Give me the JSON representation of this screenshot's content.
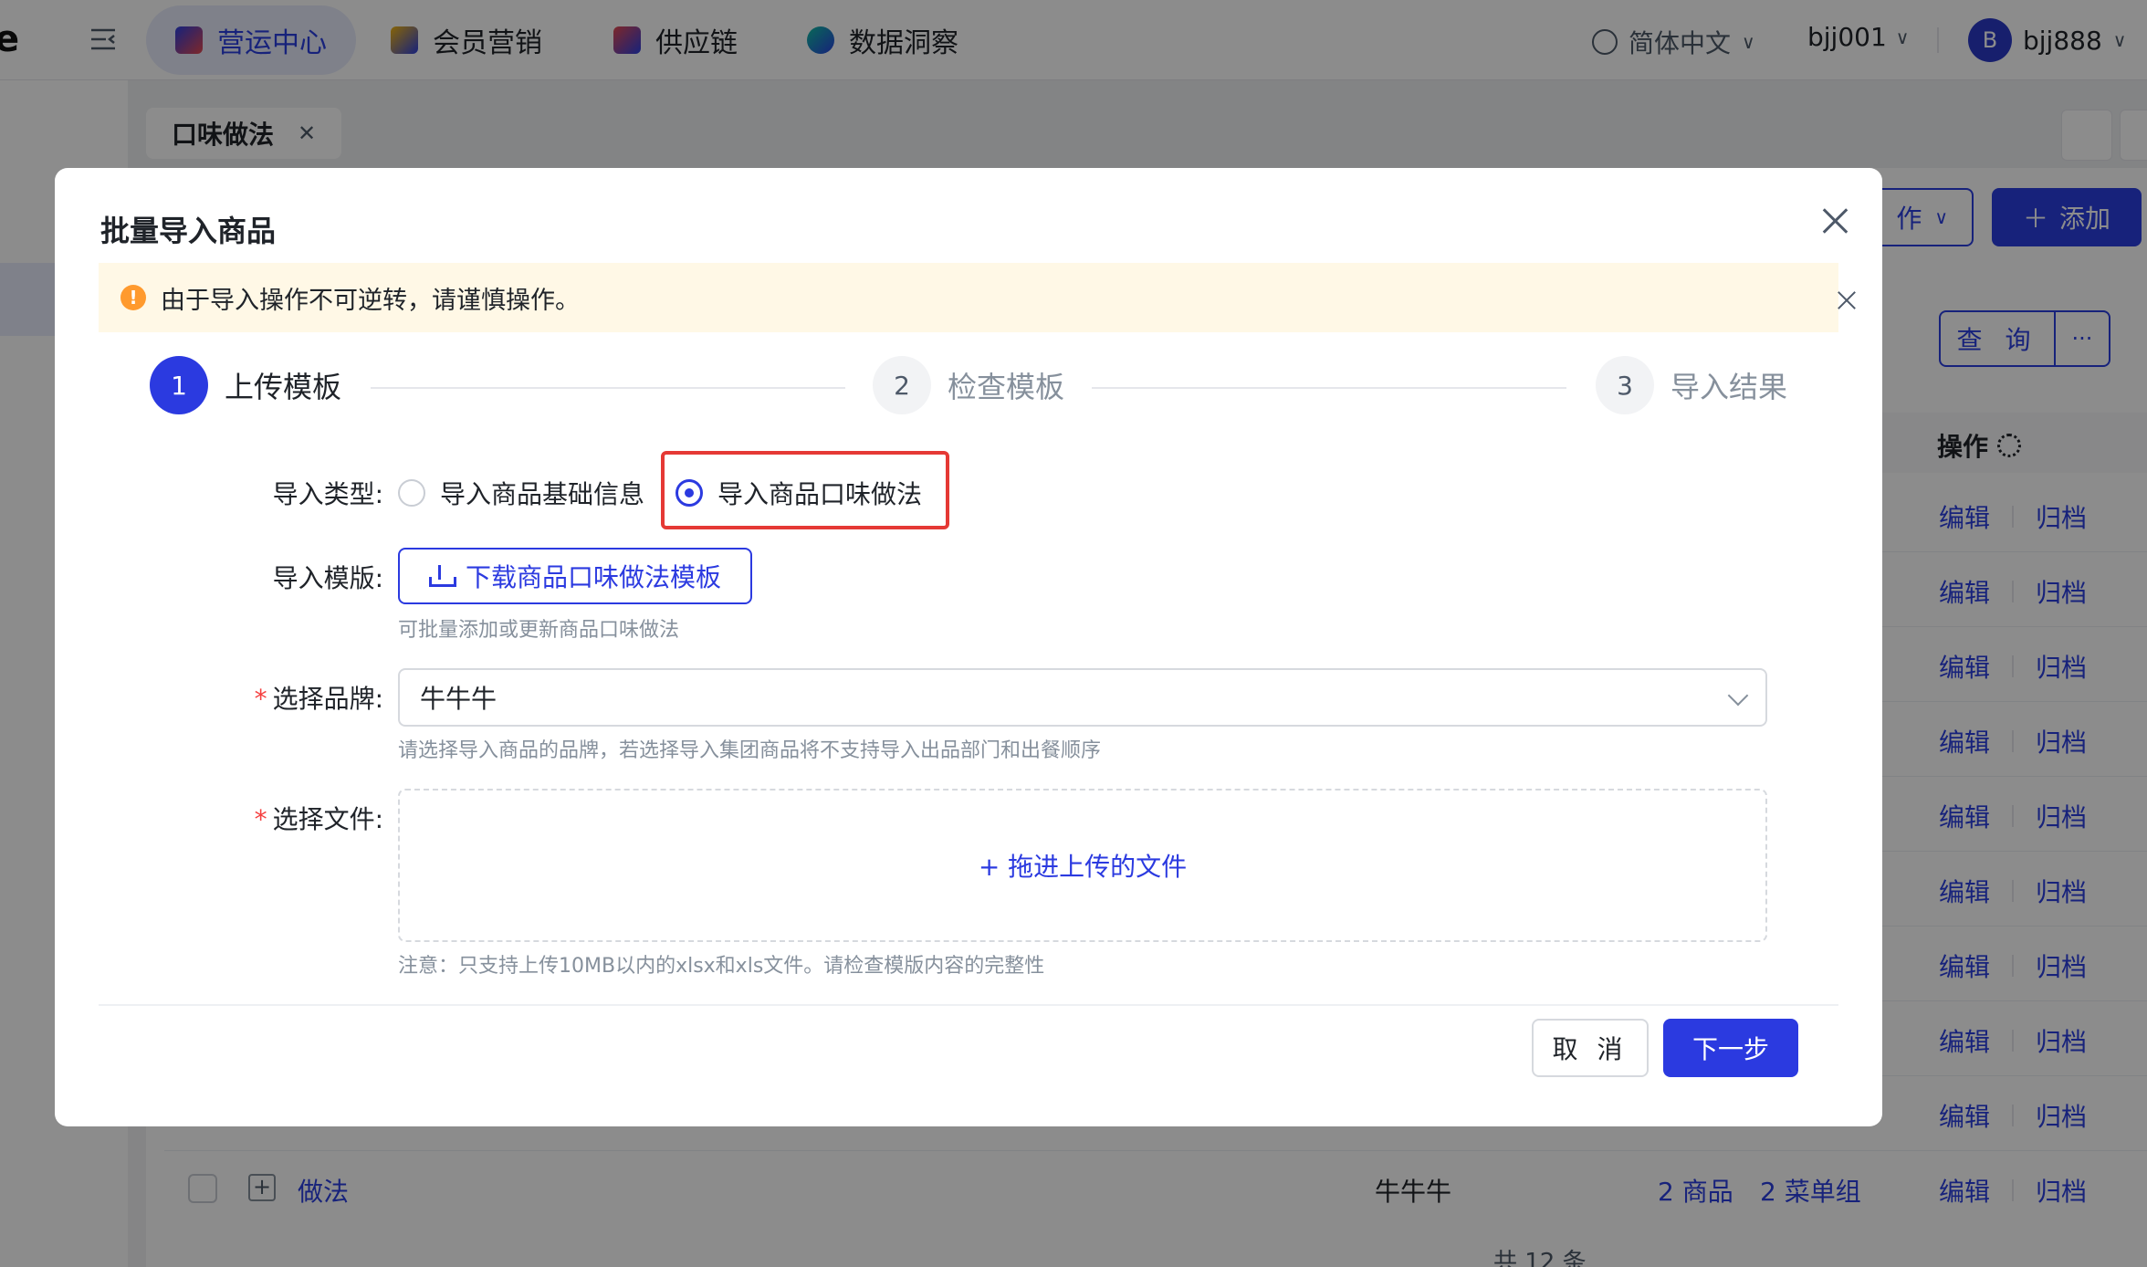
{
  "topbar": {
    "logo_fragment": "e",
    "nav": [
      {
        "label": "营运中心",
        "active": true,
        "icon": "ops-center-icon"
      },
      {
        "label": "会员营销",
        "active": false,
        "icon": "member-marketing-icon"
      },
      {
        "label": "供应链",
        "active": false,
        "icon": "supply-chain-icon"
      },
      {
        "label": "数据洞察",
        "active": false,
        "icon": "data-insight-icon"
      }
    ],
    "language": "简体中文",
    "account": "bjj001",
    "user_initial": "B",
    "user_name": "bjj888"
  },
  "tabs": [
    {
      "label": "口味做法",
      "closable": true
    }
  ],
  "background": {
    "batch_button_partial": "作",
    "add_button": "添加",
    "query_button": "查 询",
    "more_button": "···",
    "op_header": "操作",
    "row_edit": "编辑",
    "row_archive": "归档",
    "last_row": {
      "name": "做法",
      "brand": "牛牛牛",
      "product_count": "2 商品",
      "menu_group_count": "2 菜单组"
    },
    "pager_partial": "共 12 条"
  },
  "modal": {
    "title": "批量导入商品",
    "alert": "由于导入操作不可逆转，请谨慎操作。",
    "steps": [
      {
        "number": "1",
        "label": "上传模板",
        "status": "active"
      },
      {
        "number": "2",
        "label": "检查模板",
        "status": "pending"
      },
      {
        "number": "3",
        "label": "导入结果",
        "status": "pending"
      }
    ],
    "form": {
      "import_type_label": "导入类型:",
      "import_type_options": [
        {
          "label": "导入商品基础信息",
          "checked": false
        },
        {
          "label": "导入商品口味做法",
          "checked": true
        }
      ],
      "template_label": "导入模版:",
      "download_button": "下载商品口味做法模板",
      "template_hint": "可批量添加或更新商品口味做法",
      "brand_label": "选择品牌:",
      "brand_value": "牛牛牛",
      "brand_hint": "请选择导入商品的品牌，若选择导入集团商品将不支持导入出品部门和出餐顺序",
      "file_label": "选择文件:",
      "upload_text": "+ 拖进上传的文件",
      "file_hint": "注意：只支持上传10MB以内的xlsx和xls文件。请检查模版内容的完整性"
    },
    "cancel_button": "取 消",
    "next_button": "下一步"
  },
  "colors": {
    "primary": "#2b3ae0",
    "warning": "#ff9a2e",
    "danger": "#f53f3f",
    "highlight_box": "#e53935"
  }
}
